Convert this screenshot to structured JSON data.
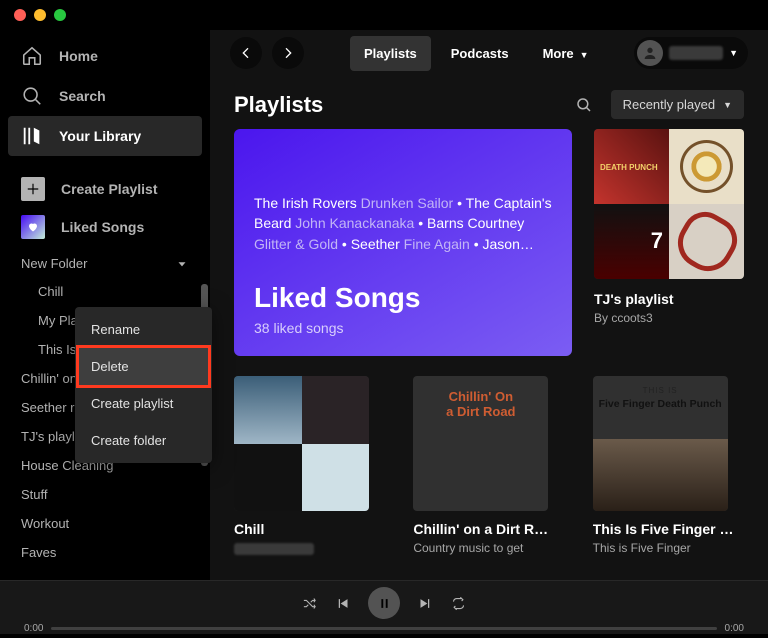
{
  "nav": {
    "home": "Home",
    "search": "Search",
    "library": "Your Library",
    "create": "Create Playlist",
    "liked": "Liked Songs"
  },
  "sidebar": {
    "folder_label": "New Folder",
    "sub": {
      "0": "Chill",
      "1": "My Pla",
      "2": "This Is"
    },
    "items": {
      "0": "Chillin' on",
      "1": "Seether ra",
      "2": "TJ's playlist",
      "3": "House Cleaning",
      "4": "Stuff",
      "5": "Workout",
      "6": "Faves"
    }
  },
  "ctx": {
    "0": "Rename",
    "1": "Delete",
    "2": "Create playlist",
    "3": "Create folder"
  },
  "tabs": {
    "0": "Playlists",
    "1": "Podcasts",
    "2": "More"
  },
  "page": {
    "title": "Playlists",
    "sort": "Recently played"
  },
  "hero": {
    "title": "Liked Songs",
    "sub": "38 liked songs",
    "t1a": "The Irish Rovers ",
    "t1b": "Drunken Sailor",
    "t2a": "The Captain's Beard ",
    "t2b": "John Kanackanaka",
    "t3a": "Barns Courtney ",
    "t3b": "Glitter & Gold",
    "t4a": "Seether ",
    "t4b": "Fine Again",
    "t5a": "Jason…"
  },
  "card_tj": {
    "title": "TJ's playlist",
    "sub": "By ccoots3"
  },
  "row2": {
    "0": {
      "title": "Chill"
    },
    "1": {
      "title": "Chillin' on a Dirt R…",
      "sub": "Country music to get"
    },
    "2": {
      "title": "This Is Five Finger …",
      "sub": "This is Five Finger"
    }
  },
  "art": {
    "dirt1": "Chillin' On",
    "dirt2": "a Dirt Road",
    "ffdp1": "THIS IS",
    "ffdp2": "Five Finger Death Punch"
  },
  "np": {
    "t0": "0:00",
    "t1": "0:00"
  }
}
